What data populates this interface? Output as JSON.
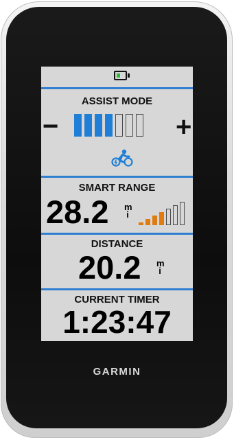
{
  "device": {
    "brand": "GARMIN"
  },
  "status": {
    "battery_level": 0.33,
    "battery_color": "#2dbb3c"
  },
  "assist_mode": {
    "label": "ASSIST MODE",
    "decrease_label": "−",
    "increase_label": "+",
    "level": 4,
    "max_level": 7,
    "active_color": "#1f7fd6",
    "icon": "ebike-icon"
  },
  "smart_range": {
    "label": "SMART RANGE",
    "value": "28.2",
    "unit_top": "m",
    "unit_bottom": "i",
    "level": 4,
    "max_level": 7,
    "active_color": "#e07b10"
  },
  "distance": {
    "label": "DISTANCE",
    "value": "20.2",
    "unit_top": "m",
    "unit_bottom": "i"
  },
  "current_timer": {
    "label": "CURRENT TIMER",
    "value": "1:23:47"
  },
  "accent_color": "#2f7fd1"
}
